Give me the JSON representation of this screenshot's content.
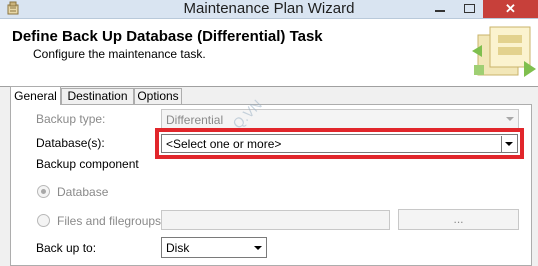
{
  "window": {
    "title": "Maintenance Plan Wizard",
    "close_glyph": "✕"
  },
  "header": {
    "title": "Define Back Up Database (Differential) Task",
    "subtitle": "Configure the maintenance task."
  },
  "tabs": [
    {
      "label": "General",
      "active": true
    },
    {
      "label": "Destination",
      "active": false
    },
    {
      "label": "Options",
      "active": false
    }
  ],
  "form": {
    "backup_type_label": "Backup type:",
    "backup_type_value": "Differential",
    "databases_label": "Database(s):",
    "databases_value": "<Select one or more>",
    "backup_component_label": "Backup component",
    "radio_database_label": "Database",
    "radio_files_label": "Files and filegroups:",
    "files_button_label": "...",
    "backup_to_label": "Back up to:",
    "backup_to_value": "Disk"
  },
  "watermark_text": "Q.VN",
  "colors": {
    "highlight_border": "#e1262b",
    "close_button": "#c7403a",
    "titlebar": "#d9e4f1"
  },
  "icons": [
    "app-icon",
    "minimize-icon",
    "maximize-icon",
    "close-icon",
    "wizard-graphic",
    "dropdown-arrow-icon"
  ]
}
